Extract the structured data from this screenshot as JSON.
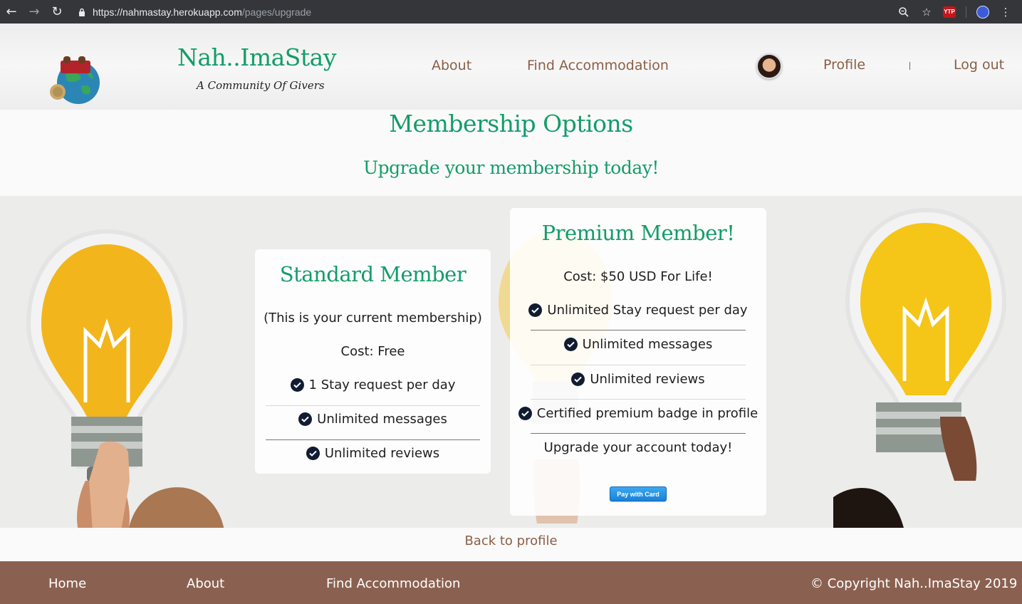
{
  "browser": {
    "url_host": "https://nahmastay.herokuapp.com",
    "url_path": "/pages/upgrade",
    "ext_label": "YTP"
  },
  "header": {
    "brand": "Nah..ImaStay",
    "tagline": "A Community Of Givers",
    "nav": {
      "about": "About",
      "find": "Find Accommodation",
      "profile": "Profile",
      "logout": "Log out"
    }
  },
  "page": {
    "title": "Membership Options",
    "subtitle": "Upgrade your membership today!"
  },
  "standard": {
    "title": "Standard Member",
    "current": "(This is your current membership)",
    "cost": "Cost: Free",
    "features": [
      "1 Stay request per day",
      "Unlimited messages",
      "Unlimited reviews"
    ]
  },
  "premium": {
    "title": "Premium Member!",
    "cost": "Cost: $50 USD For Life!",
    "features": [
      "Unlimited Stay request per day",
      "Unlimited messages",
      "Unlimited reviews",
      "Certified premium badge in profile"
    ],
    "cta_text": "Upgrade your account today!",
    "pay_button": "Pay with Card"
  },
  "back_link": "Back to profile",
  "footer": {
    "home": "Home",
    "about": "About",
    "find": "Find Accommodation",
    "copyright": "© Copyright Nah..ImaStay 2019"
  },
  "colors": {
    "brand_green": "#149c6b",
    "brown": "#8b5e45",
    "footer_bg": "#8a6151",
    "pay_blue": "#1a82d8"
  }
}
